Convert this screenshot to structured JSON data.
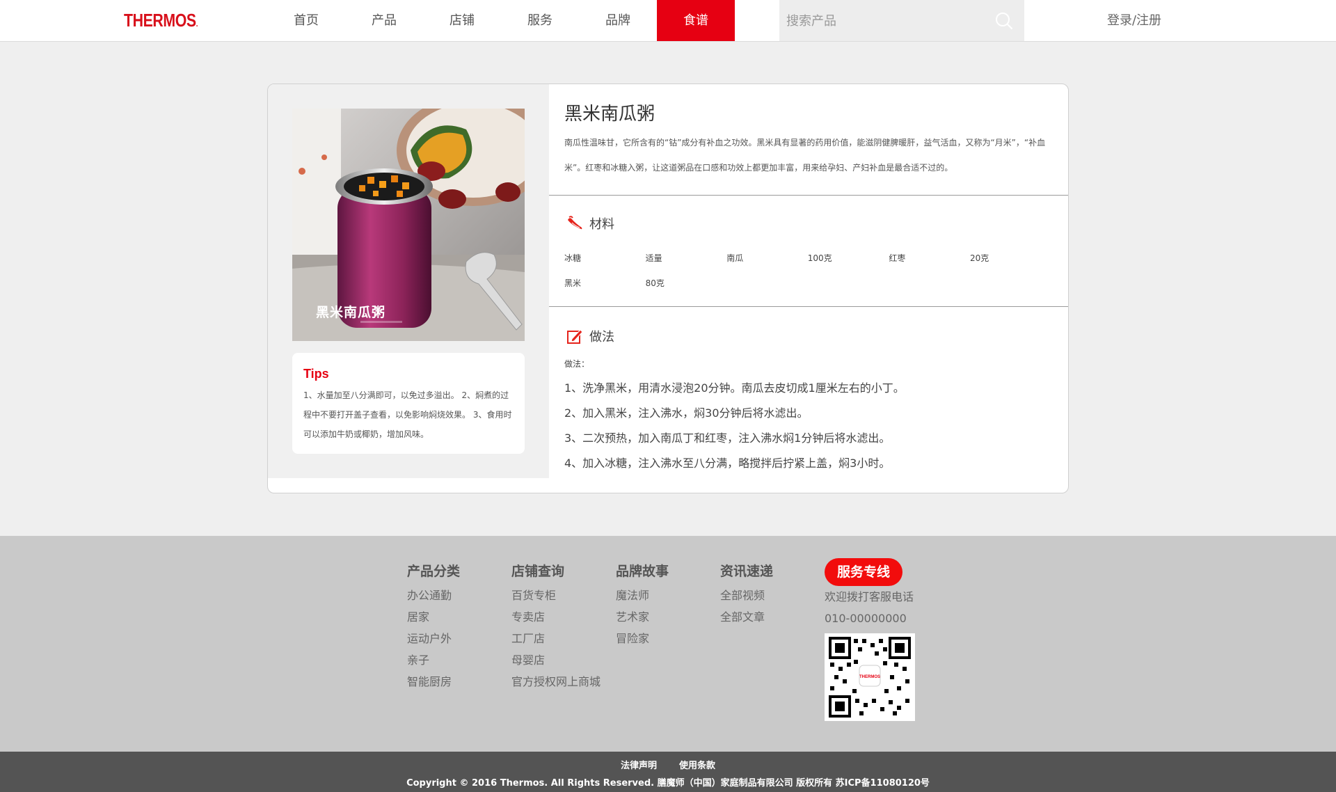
{
  "brand": {
    "logo": "THERMOS",
    "logo_mark": ".",
    "accent": "#e60012"
  },
  "nav": {
    "items": [
      "首页",
      "产品",
      "店铺",
      "服务",
      "品牌",
      "食谱"
    ],
    "active": "食谱"
  },
  "search": {
    "placeholder": "搜索产品",
    "icon": "search-icon"
  },
  "account": {
    "login_label": "登录/注册"
  },
  "recipe": {
    "title": "黑米南瓜粥",
    "photo_caption": "黑米南瓜粥",
    "description": "南瓜性温味甘，它所含有的“钴”成分有补血之功效。黑米具有显著的药用价值，能滋阴健脾暖肝，益气活血，又称为“月米”，“补血米”。红枣和冰糖入粥，让这道粥品在口感和功效上都更加丰富，用来给孕妇、产妇补血是最合适不过的。",
    "tips": {
      "title": "Tips",
      "text": "1、水量加至八分满即可，以免过多溢出。 2、焖煮的过程中不要打开盖子查看，以免影响焖烧效果。 3、食用时可以添加牛奶或椰奶，增加风味。"
    },
    "ingredients": {
      "title": "材料",
      "icon": "chili-pepper-icon",
      "rows": [
        [
          "冰糖",
          "适量",
          "南瓜",
          "100克",
          "红枣",
          "20克"
        ],
        [
          "黑米",
          "80克"
        ]
      ]
    },
    "method": {
      "title": "做法",
      "icon": "edit-icon",
      "label": "做法：",
      "steps": [
        "1、洗净黑米，用清水浸泡20分钟。南瓜去皮切成1厘米左右的小丁。",
        "2、加入黑米，注入沸水，焖30分钟后将水滤出。",
        "3、二次预热，加入南瓜丁和红枣，注入沸水焖1分钟后将水滤出。",
        "4、加入冰糖，注入沸水至八分满，略搅拌后拧紧上盖，焖3小时。"
      ]
    }
  },
  "footer": {
    "columns": [
      {
        "title": "产品分类",
        "links": [
          "办公通勤",
          "居家",
          "运动户外",
          "亲子",
          "智能厨房"
        ]
      },
      {
        "title": "店铺查询",
        "links": [
          "百货专柜",
          "专卖店",
          "工厂店",
          "母婴店",
          "官方授权网上商城"
        ]
      },
      {
        "title": "品牌故事",
        "links": [
          "魔法师",
          "艺术家",
          "冒险家"
        ]
      },
      {
        "title": "资讯速递",
        "links": [
          "全部视频",
          "全部文章"
        ]
      }
    ],
    "service": {
      "button": "服务专线",
      "text": "欢迎拨打客服电话",
      "phone": "010-00000000",
      "qr_logo": "THERMOS"
    },
    "legal_links": [
      "法律声明",
      "使用条款"
    ],
    "copyright": "Copyright © 2016 Thermos. All Rights Reserved. 膳魔师（中国）家庭制品有限公司 版权所有 苏ICP备11080120号"
  }
}
